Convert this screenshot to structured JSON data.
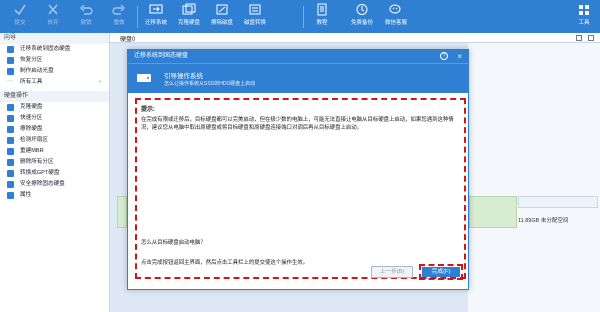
{
  "toolbar": {
    "items": [
      {
        "label": "提交",
        "icon": "check-icon"
      },
      {
        "label": "放弃",
        "icon": "discard-icon"
      },
      {
        "label": "撤销",
        "icon": "undo-icon"
      },
      {
        "label": "重做",
        "icon": "redo-icon"
      },
      {
        "label": "迁移系统",
        "icon": "migrate-os-icon"
      },
      {
        "label": "克隆硬盘",
        "icon": "clone-disk-icon"
      },
      {
        "label": "擦除磁盘",
        "icon": "wipe-disk-icon"
      },
      {
        "label": "磁盘转换",
        "icon": "disk-convert-icon"
      },
      {
        "label": "教程",
        "icon": "tutorial-icon"
      },
      {
        "label": "免费备份",
        "icon": "backup-icon"
      },
      {
        "label": "微信客服",
        "icon": "wechat-icon"
      },
      {
        "label": "工具",
        "icon": "tools-icon"
      }
    ]
  },
  "sidebar": {
    "wizard_header": "向导",
    "wizard_items": [
      {
        "label": "迁移系统到固态硬盘"
      },
      {
        "label": "恢复分区"
      },
      {
        "label": "制作启动光盘"
      },
      {
        "label": "所有工具"
      }
    ],
    "disk_header": "硬盘操作",
    "disk_items": [
      {
        "label": "克隆硬盘"
      },
      {
        "label": "快速分区"
      },
      {
        "label": "擦除硬盘"
      },
      {
        "label": "检测坏扇区"
      },
      {
        "label": "重建MBR"
      },
      {
        "label": "删除所有分区"
      },
      {
        "label": "转换成GPT硬盘"
      },
      {
        "label": "安全擦除固态硬盘"
      },
      {
        "label": "属性"
      }
    ]
  },
  "main": {
    "disk_label": "硬盘0",
    "free_space": "11.89GB 未分配空间"
  },
  "dialog": {
    "title": "迁移系统到固态硬盘",
    "header_title": "引导操作系统",
    "header_subtitle": "怎么让操作系统从SSD的HDD硬盘上启动",
    "hint_heading": "提示:",
    "hint_text": "在完成有限或迁移后，目标硬盘都可以完美启动，但在极少数的电脑上，可能无法直接让电脑从目标硬盘上启动，如果您遇到这种情况，建议您从电脑中取出原硬盘或将目标硬盘和原硬盘连接端口对调后再从目标硬盘上启动。",
    "question": "怎么从目标硬盘启动电脑？",
    "instruction": "点击完成按钮返回主界面，然后点击工具栏上的提交使这个操作生效。",
    "prev_button": "上一步(B)",
    "finish_button": "完成(F)"
  }
}
